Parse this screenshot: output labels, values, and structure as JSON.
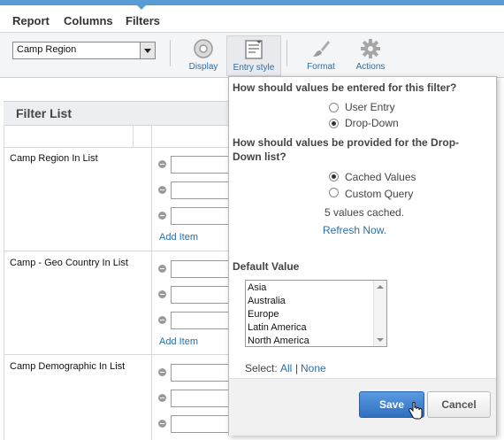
{
  "menu": {
    "report": "Report",
    "columns": "Columns",
    "filters": "Filters"
  },
  "toolbar": {
    "field_select": "Camp Region",
    "display": "Display",
    "entry_style": "Entry style",
    "format": "Format",
    "actions": "Actions"
  },
  "filter_list": {
    "title": "Filter List",
    "rows": [
      {
        "label": "Camp Region In List",
        "add_item": "Add Item"
      },
      {
        "label": "Camp - Geo Country In List",
        "add_item": "Add Item"
      },
      {
        "label": "Camp Demographic In List"
      }
    ]
  },
  "popup": {
    "q_entry": "How should values be entered for this filter?",
    "opt_user_entry": "User Entry",
    "opt_dropdown": "Drop-Down",
    "q_provided": "How should values be provided for the Drop-Down list?",
    "opt_cached": "Cached Values",
    "opt_custom": "Custom Query",
    "cached_count": "5 values cached.",
    "refresh": "Refresh Now.",
    "default_value_label": "Default Value",
    "default_values": [
      "Asia",
      "Australia",
      "Europe",
      "Latin America",
      "North America"
    ],
    "select_label": "Select:",
    "select_all": "All",
    "select_sep": "|",
    "select_none": "None",
    "save": "Save",
    "cancel": "Cancel"
  },
  "colors": {
    "accent": "#5b9bd5",
    "link": "#2a6ea6",
    "save_button": "#3b7dcc"
  }
}
